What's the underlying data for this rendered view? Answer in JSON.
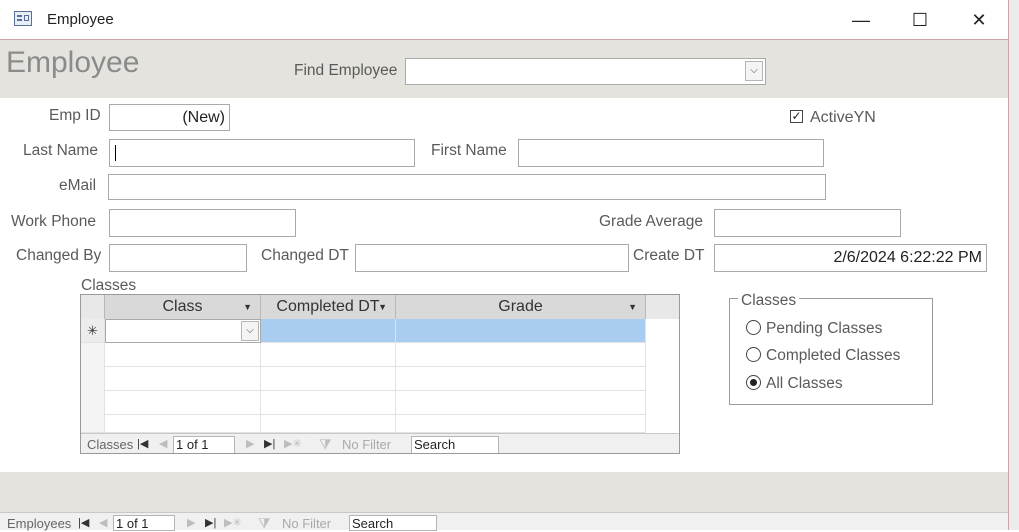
{
  "window": {
    "title": "Employee",
    "minimize": "—",
    "maximize": "☐",
    "close": "✕"
  },
  "header": {
    "form_title": "Employee",
    "find_label": "Find Employee",
    "find_value": ""
  },
  "fields": {
    "emp_id_label": "Emp ID",
    "emp_id_value": "(New)",
    "active_label": "ActiveYN",
    "active_checked": "✓",
    "last_name_label": "Last Name",
    "last_name_value": "",
    "first_name_label": "First Name",
    "first_name_value": "",
    "email_label": "eMail",
    "email_value": "",
    "work_phone_label": "Work Phone",
    "work_phone_value": "",
    "grade_avg_label": "Grade Average",
    "grade_avg_value": "",
    "changed_by_label": "Changed By",
    "changed_by_value": "",
    "changed_dt_label": "Changed DT",
    "changed_dt_value": "",
    "create_dt_label": "Create DT",
    "create_dt_value": "2/6/2024 6:22:22 PM"
  },
  "classes_subform": {
    "label": "Classes",
    "columns": [
      "Class",
      "Completed DT",
      "Grade"
    ],
    "new_row_marker": "✳",
    "nav": {
      "label": "Classes",
      "record": "1 of 1",
      "filter": "No Filter",
      "search": "Search"
    }
  },
  "classes_filter": {
    "legend": "Classes",
    "options": [
      {
        "label": "Pending Classes",
        "selected": false
      },
      {
        "label": "Completed Classes",
        "selected": false
      },
      {
        "label": "All Classes",
        "selected": true
      }
    ]
  },
  "bottom_nav": {
    "label": "Employees",
    "record": "1 of 1",
    "filter": "No Filter",
    "search": "Search"
  },
  "icons": {
    "first": "first-record-icon",
    "prev": "previous-record-icon",
    "next": "next-record-icon",
    "last": "last-record-icon",
    "new": "new-record-icon",
    "filter": "filter-icon"
  },
  "colors": {
    "header_bg": "#e4e3dd",
    "selected_row": "#a8cdf0",
    "grid_header": "#d9d9d9"
  }
}
